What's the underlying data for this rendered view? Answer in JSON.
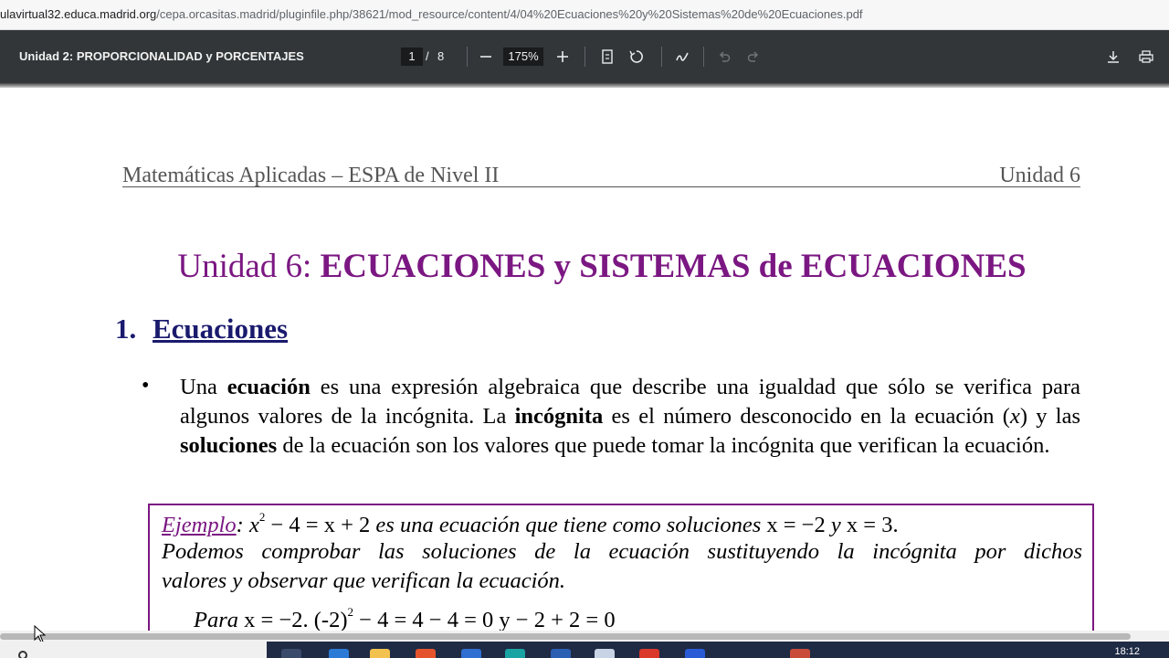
{
  "browser": {
    "url_host": "ulavirtual32.educa.madrid.org",
    "url_path": "/cepa.orcasitas.madrid/pluginfile.php/38621/mod_resource/content/4/04%20Ecuaciones%20y%20Sistemas%20de%20Ecuaciones.pdf"
  },
  "toolbar": {
    "title": "Unidad 2: PROPORCIONALIDAD y PORCENTAJES",
    "page_current": "1",
    "page_separator": "/",
    "page_total": "8",
    "zoom": "175%"
  },
  "document": {
    "header_left": "Matemáticas Aplicadas – ESPA de Nivel II",
    "header_right": "Unidad 6",
    "title_prefix": "Unidad 6: ",
    "title_main": "ECUACIONES y SISTEMAS de ECUACIONES",
    "section_number": "1.",
    "section_title": "Ecuaciones",
    "bullet": "•",
    "para": {
      "p1": "Una ",
      "b1": "ecuación",
      "p2": " es una expresión algebraica que describe una igualdad que sólo se verifica para algunos valores de la incógnita. La ",
      "b2": "incógnita",
      "p3": " es el número desconocido en la ecuación (",
      "var": "x",
      "p4": ") y las ",
      "b3": "soluciones",
      "p5": " de la ecuación son los valores que puede tomar la incógnita que verifican la ecuación."
    },
    "example": {
      "label": "Ejemplo",
      "colon": ":",
      "eq_a": "x",
      "eq_sup": "2",
      "eq_b": " − 4 = x + 2",
      "text1": " es una ecuación que tiene como soluciones ",
      "sol1": "x = −2",
      "y": " y ",
      "sol2": "x = 3",
      "dot": ".",
      "line2": "Podemos comprobar las soluciones de la ecuación sustituyendo la incógnita por dichos",
      "line3": "valores y observar que verifican la ecuación.",
      "line4_a": "Para ",
      "line4_b": "x = −2",
      "line4_c": ".   (-2)",
      "line4_sup": "2",
      "line4_d": " − 4 = 4 − 4 = 0     y     − 2 + 2 = 0"
    }
  },
  "taskbar": {
    "clock": "18:12"
  },
  "colors": {
    "accent_purple": "#7b1782",
    "section_blue": "#1a1a6e",
    "toolbar_bg": "#323639"
  }
}
